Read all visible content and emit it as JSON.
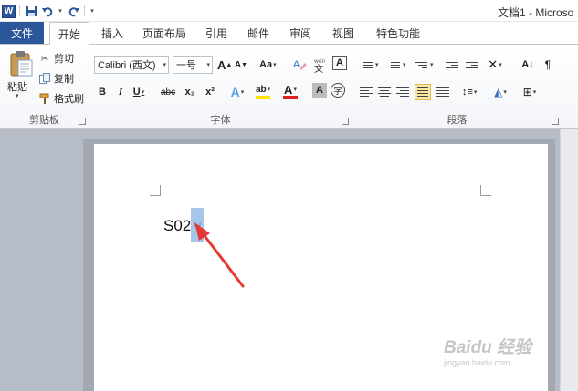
{
  "app": {
    "logo": "W",
    "title": "文档1 - Microso"
  },
  "qat": {
    "save_icon": "save-icon",
    "undo_icon": "undo-icon",
    "redo_icon": "redo-icon"
  },
  "tabs": {
    "file": "文件",
    "items": [
      "开始",
      "插入",
      "页面布局",
      "引用",
      "邮件",
      "审阅",
      "视图",
      "特色功能"
    ]
  },
  "ribbon": {
    "clipboard": {
      "paste": "粘贴",
      "cut": "剪切",
      "copy": "复制",
      "format_painter": "格式刷",
      "label": "剪贴板"
    },
    "font": {
      "font_name": "Calibri (西文)",
      "font_size": "一号",
      "label": "字体",
      "grow": "A",
      "shrink": "A",
      "case": "Aa",
      "clear": "A",
      "bold": "B",
      "italic": "I",
      "underline": "U",
      "strike": "abc",
      "subscript": "x₂",
      "superscript": "x²",
      "text_effect": "A",
      "highlight": "ab",
      "font_color": "A",
      "char_shading": "A",
      "enclose": "字"
    },
    "paragraph": {
      "label": "段落"
    }
  },
  "document": {
    "text": "S02",
    "selected_char": "",
    "para_mark": "↵"
  },
  "watermark": {
    "main": "Baidu 经验",
    "sub": "jingyan.baidu.com"
  },
  "colors": {
    "accent": "#2b579a",
    "selection": "#a7c7ea",
    "arrow": "#e53935",
    "canvas": "#b6bdc7"
  }
}
